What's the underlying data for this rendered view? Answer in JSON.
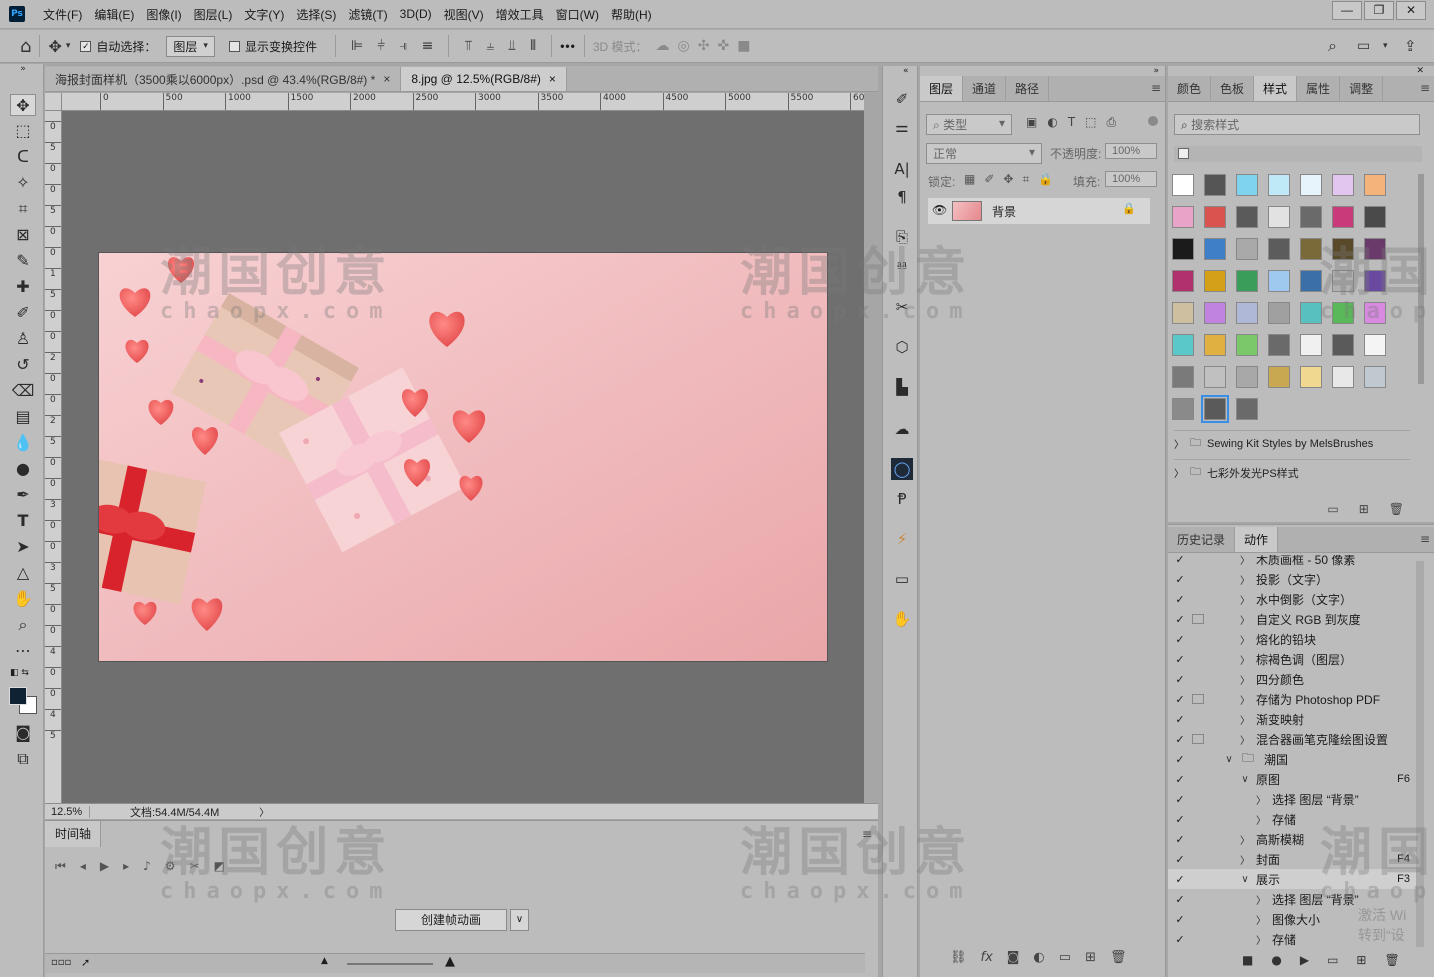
{
  "app": {
    "logo": "Ps",
    "menus": [
      "文件(F)",
      "编辑(E)",
      "图像(I)",
      "图层(L)",
      "文字(Y)",
      "选择(S)",
      "滤镜(T)",
      "3D(D)",
      "视图(V)",
      "增效工具",
      "窗口(W)",
      "帮助(H)"
    ]
  },
  "options": {
    "auto_select_label": "自动选择：",
    "auto_select_target": "图层",
    "transform_label": "显示变换控件",
    "more_label": "•••",
    "mode3d_label": "3D 模式："
  },
  "tabs": [
    {
      "title": "海报封面样机（3500乘以6000px）.psd @ 43.4%(RGB/8#) *",
      "close": "×"
    },
    {
      "title": "8.jpg @ 12.5%(RGB/8#)",
      "close": "×"
    }
  ],
  "ruler": {
    "h_labels": [
      "0",
      "500",
      "1000",
      "1500",
      "2000",
      "2500",
      "3000",
      "3500",
      "4000",
      "4500",
      "5000",
      "5500",
      "60"
    ],
    "v_labels": [
      "0",
      "5",
      "0",
      "0",
      "5",
      "0",
      "0",
      "1",
      "5",
      "0",
      "0",
      "2",
      "0",
      "0",
      "2",
      "5",
      "0",
      "0",
      "3",
      "0",
      "0",
      "3",
      "5",
      "0",
      "0",
      "4",
      "0",
      "0",
      "4",
      "5"
    ]
  },
  "status": {
    "zoom": "12.5%",
    "doc_info": "文档:54.4M/54.4M",
    "arrow": "〉"
  },
  "timeline": {
    "tab_label": "时间轴",
    "create_button": "创建帧动画"
  },
  "layers_panel": {
    "tabs": [
      "图层",
      "通道",
      "路径"
    ],
    "filter_label": "类型",
    "blend_mode": "正常",
    "opacity_label": "不透明度:",
    "opacity_value": "100%",
    "lock_label": "锁定:",
    "fill_label": "填充:",
    "fill_value": "100%",
    "layer_name": "背景"
  },
  "styles_panel": {
    "tabs": [
      "颜色",
      "色板",
      "样式",
      "属性",
      "调整"
    ],
    "search_placeholder": "搜索样式",
    "folders": [
      "Sewing Kit Styles by MelsBrushes",
      "七彩外发光PS样式"
    ],
    "swatches": [
      [
        "#ffffff",
        "#555555",
        "#7fd3ef",
        "#bfe9f7",
        "#e8f4fb",
        "#e3c6f0",
        "#f4b37a"
      ],
      [
        "#e8a3c9",
        "#d9534f",
        "#5a5a5a",
        "#e2e2e2",
        "#6a6a6a",
        "#c83a7a",
        "#4a4a4a"
      ],
      [
        "#1b1b1b",
        "#3f7fc8",
        "#a9a9a9",
        "#5c5c5c",
        "#7a6a3a",
        "#5a4a2a",
        "#6a3a6a"
      ],
      [
        "#b0316d",
        "#d4a017",
        "#3a9d5a",
        "#9fc9ef",
        "#3a6fa8",
        "#b0b0b0",
        "#6a4aa0"
      ],
      [
        "#cdbfa0",
        "#c084e0",
        "#b0b8d8",
        "#a0a0a0",
        "#59c0c0",
        "#5ab85a",
        "#d88ae0"
      ],
      [
        "#5ac8c8",
        "#e0b040",
        "#7ac86a",
        "#6a6a6a",
        "#f0f0f0",
        "#5a5a5a",
        "#f4f4f4"
      ],
      [
        "#7a7a7a",
        "#c0c0c0",
        "#a8a8a8",
        "#c8a850",
        "#f0d890",
        "#e8e8e8",
        "#c0c8d0"
      ],
      [
        "#8a8a8a",
        "#5a5a5a",
        "#6a6a6a"
      ]
    ]
  },
  "actions_panel": {
    "tabs": [
      "历史记录",
      "动作"
    ],
    "rows": [
      {
        "name": "木质画框 - 50 像素",
        "level": 1,
        "arrow": "〉",
        "dialog": false,
        "key": ""
      },
      {
        "name": "投影（文字）",
        "level": 1,
        "arrow": "〉",
        "dialog": false,
        "key": ""
      },
      {
        "name": "水中倒影（文字）",
        "level": 1,
        "arrow": "〉",
        "dialog": false,
        "key": ""
      },
      {
        "name": "自定义 RGB 到灰度",
        "level": 1,
        "arrow": "〉",
        "dialog": true,
        "key": ""
      },
      {
        "name": "熔化的铅块",
        "level": 1,
        "arrow": "〉",
        "dialog": false,
        "key": ""
      },
      {
        "name": "棕褐色调（图层）",
        "level": 1,
        "arrow": "〉",
        "dialog": false,
        "key": ""
      },
      {
        "name": "四分颜色",
        "level": 1,
        "arrow": "〉",
        "dialog": false,
        "key": ""
      },
      {
        "name": "存储为 Photoshop PDF",
        "level": 1,
        "arrow": "〉",
        "dialog": true,
        "key": ""
      },
      {
        "name": "渐变映射",
        "level": 1,
        "arrow": "〉",
        "dialog": false,
        "key": ""
      },
      {
        "name": "混合器画笔克隆绘图设置",
        "level": 1,
        "arrow": "〉",
        "dialog": true,
        "key": ""
      },
      {
        "name": "潮国",
        "level": 0,
        "arrow": "∨",
        "dialog": false,
        "key": "",
        "folder": true
      },
      {
        "name": "原图",
        "level": 1,
        "arrow": "∨",
        "dialog": false,
        "key": "F6"
      },
      {
        "name": "选择 图层 “背景”",
        "level": 2,
        "arrow": "〉",
        "dialog": false,
        "key": ""
      },
      {
        "name": "存储",
        "level": 2,
        "arrow": "〉",
        "dialog": false,
        "key": ""
      },
      {
        "name": "高斯模糊",
        "level": 1,
        "arrow": "〉",
        "dialog": false,
        "key": ""
      },
      {
        "name": "封面",
        "level": 1,
        "arrow": "〉",
        "dialog": false,
        "key": "F4"
      },
      {
        "name": "展示",
        "level": 1,
        "arrow": "∨",
        "dialog": false,
        "key": "F3",
        "selected": true
      },
      {
        "name": "选择 图层 “背景”",
        "level": 2,
        "arrow": "〉",
        "dialog": false,
        "key": ""
      },
      {
        "name": "图像大小",
        "level": 2,
        "arrow": "〉",
        "dialog": false,
        "key": ""
      },
      {
        "name": "存储",
        "level": 2,
        "arrow": "〉",
        "dialog": false,
        "key": ""
      }
    ]
  },
  "watermark": {
    "big": "潮国创意",
    "small": "chaopx.com",
    "activate": "激活 Wi",
    "activate2": "转到“设"
  }
}
